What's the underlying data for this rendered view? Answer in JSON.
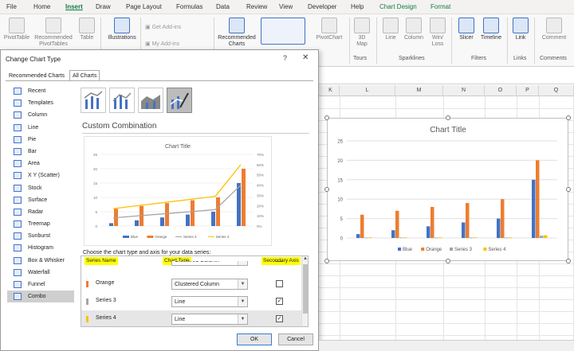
{
  "ribbon": {
    "tabs": [
      "File",
      "Home",
      "Insert",
      "Draw",
      "Page Layout",
      "Formulas",
      "Data",
      "Review",
      "View",
      "Developer",
      "Help",
      "Chart Design",
      "Format"
    ],
    "active_tab": "Insert",
    "buttons": {
      "pivottable": "PivotTable",
      "recommended_pivottables": "Recommended PivotTables",
      "table": "Table",
      "illustrations": "Illustrations",
      "get_addins": "Get Add-ins",
      "my_addins": "My Add-ins",
      "recommended_charts": "Recommended Charts",
      "pivotchart": "PivotChart",
      "map3d": "3D Map",
      "line": "Line",
      "column": "Column",
      "winloss": "Win/ Loss",
      "slicer": "Slicer",
      "timeline": "Timeline",
      "link": "Link",
      "comment": "Comment"
    },
    "groups": [
      "Tours",
      "Sparklines",
      "Filters",
      "Links",
      "Comments"
    ]
  },
  "sheet": {
    "columns": [
      "K",
      "L",
      "M",
      "N",
      "O",
      "P",
      "Q"
    ]
  },
  "dialog": {
    "title": "Change Chart Type",
    "help": "?",
    "close": "✕",
    "tabs": [
      "Recommended Charts",
      "All Charts"
    ],
    "active_tab": "All Charts",
    "chart_types": [
      "Recent",
      "Templates",
      "Column",
      "Line",
      "Pie",
      "Bar",
      "Area",
      "X Y (Scatter)",
      "Stock",
      "Surface",
      "Radar",
      "Treemap",
      "Sunburst",
      "Histogram",
      "Box & Whisker",
      "Waterfall",
      "Funnel",
      "Combo"
    ],
    "selected_type": "Combo",
    "subtype_heading": "Custom Combination",
    "choose_label": "Choose the chart type and axis for your data series:",
    "table_headers": {
      "series_name": "Series Name",
      "chart_type": "Chart Type",
      "secondary_axis": "Secondary Axis"
    },
    "series_rows": [
      {
        "name": "Blue",
        "chart_type": "Clustered Column",
        "secondary": false,
        "color": "#4472c4"
      },
      {
        "name": "Orange",
        "chart_type": "Clustered Column",
        "secondary": false,
        "color": "#ed7d31"
      },
      {
        "name": "Series 3",
        "chart_type": "Line",
        "secondary": true,
        "color": "#a5a5a5"
      },
      {
        "name": "Series 4",
        "chart_type": "Line",
        "secondary": true,
        "color": "#ffc000"
      }
    ],
    "ok": "OK",
    "cancel": "Cancel"
  },
  "chart_data": [
    {
      "type": "bar",
      "title": "Chart Title",
      "categories": [
        "1",
        "2",
        "3",
        "4",
        "5",
        "6"
      ],
      "ylim": [
        0,
        25
      ],
      "yticks": [
        "0",
        "5",
        "10",
        "15",
        "20",
        "25"
      ],
      "series": [
        {
          "name": "Blue",
          "color": "#4472c4",
          "values": [
            1,
            2,
            3,
            4,
            5,
            15
          ]
        },
        {
          "name": "Orange",
          "color": "#ed7d31",
          "values": [
            6,
            7,
            8,
            9,
            10,
            20
          ]
        },
        {
          "name": "Series 3",
          "color": "#a5a5a5",
          "values": [
            0.1,
            0.1,
            0.1,
            0.1,
            0.1,
            0.6
          ]
        },
        {
          "name": "Series 4",
          "color": "#ffc000",
          "values": [
            0.15,
            0.15,
            0.15,
            0.15,
            0.15,
            0.7
          ]
        }
      ],
      "legend": "bottom"
    },
    {
      "type": "bar",
      "title": "Chart Title",
      "categories": [
        "1",
        "2",
        "3",
        "4",
        "5",
        "6"
      ],
      "ylim": [
        0,
        25
      ],
      "yticks": [
        "0",
        "5",
        "10",
        "15",
        "20",
        "25"
      ],
      "y2lim": [
        0,
        0.7
      ],
      "y2ticks": [
        "0%",
        "10%",
        "20%",
        "30%",
        "40%",
        "50%",
        "60%",
        "70%"
      ],
      "series": [
        {
          "name": "Blue",
          "type": "bar",
          "color": "#4472c4",
          "values": [
            1,
            2,
            3,
            4,
            5,
            15
          ]
        },
        {
          "name": "Orange",
          "type": "bar",
          "color": "#ed7d31",
          "values": [
            6,
            7,
            8,
            9,
            10,
            20
          ]
        },
        {
          "name": "Series 3",
          "type": "line",
          "axis": "secondary",
          "color": "#a5a5a5",
          "values": [
            0.08,
            0.1,
            0.12,
            0.14,
            0.16,
            0.4
          ]
        },
        {
          "name": "Series 4",
          "type": "line",
          "axis": "secondary",
          "color": "#ffc000",
          "values": [
            0.17,
            0.2,
            0.23,
            0.26,
            0.29,
            0.6
          ]
        }
      ],
      "legend": "bottom"
    }
  ]
}
